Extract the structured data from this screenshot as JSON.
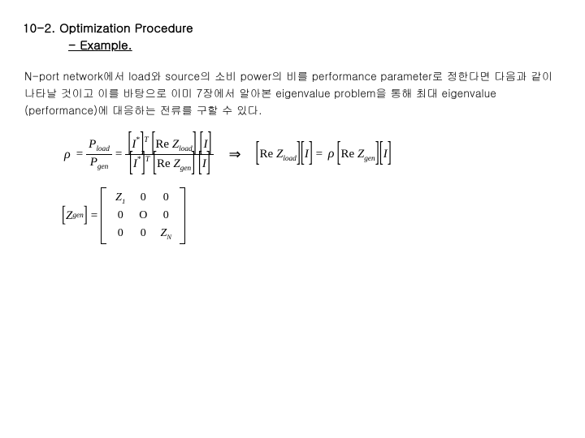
{
  "title": "10-2. Optimization Procedure",
  "subtitle": "- Example.",
  "paragraph": " N-port network에서 load와 source의 소비 power의 비를 performance parameter로 정한다면 다음과 같이 나타날 것이고 이를 바탕으로 이미 7장에서 알아본 eigenvalue problem을 통해 최대 eigenvalue (performance)에 대응하는 전류를 구할 수 있다.",
  "eq1": {
    "lhs_symbol": "ρ",
    "pfrac_num": "P",
    "pfrac_num_sub": "load",
    "pfrac_den": "P",
    "pfrac_den_sub": "gen",
    "ifrac": {
      "Istar": "I",
      "star_sup": "*",
      "T_sup": "T",
      "Re": "Re",
      "Z": "Z",
      "Z_num_sub": "load",
      "Z_den_sub": "gen",
      "I": "I"
    },
    "arrow": "⇒",
    "rhs": {
      "Re": "Re",
      "Z": "Z",
      "Z_sub_l": "load",
      "I": "I",
      "rho": "ρ",
      "Z_sub_g": "gen"
    }
  },
  "eq2": {
    "label_Z": "Z",
    "label_sub": "gen",
    "matrix": {
      "r1c1": "Z",
      "r1c1_sub": "1",
      "r1c2": "0",
      "r1c3": "0",
      "r2c1": "0",
      "r2c2": "O",
      "r2c3": "0",
      "r3c1": "0",
      "r3c2": "0",
      "r3c3": "Z",
      "r3c3_sub": "N"
    }
  }
}
